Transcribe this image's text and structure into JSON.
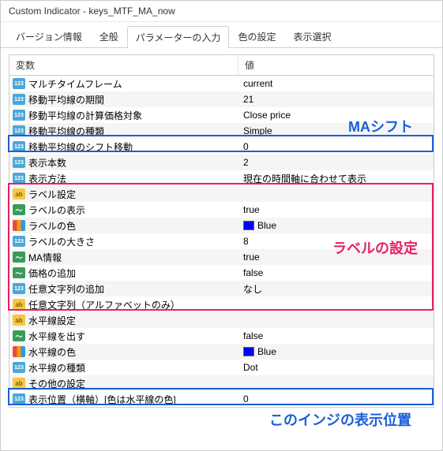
{
  "window": {
    "title": "Custom Indicator - keys_MTF_MA_now"
  },
  "tabs": [
    {
      "label": "バージョン情報"
    },
    {
      "label": "全般"
    },
    {
      "label": "パラメーターの入力"
    },
    {
      "label": "色の設定"
    },
    {
      "label": "表示選択"
    }
  ],
  "headers": {
    "variable": "変数",
    "value": "値"
  },
  "rows": [
    {
      "icon": "123",
      "var": "マルチタイムフレーム",
      "val": "current",
      "alt": false
    },
    {
      "icon": "123",
      "var": "移動平均線の期間",
      "val": "21",
      "alt": true
    },
    {
      "icon": "123",
      "var": "移動平均線の計算価格対象",
      "val": "Close price",
      "alt": false
    },
    {
      "icon": "123",
      "var": "移動平均線の種類",
      "val": "Simple",
      "alt": true
    },
    {
      "icon": "123",
      "var": "移動平均線のシフト移動",
      "val": "0",
      "alt": false
    },
    {
      "icon": "123",
      "var": "表示本数",
      "val": "2",
      "alt": true
    },
    {
      "icon": "123",
      "var": "表示方法",
      "val": "現在の時間軸に合わせて表示",
      "alt": false
    },
    {
      "icon": "ab",
      "var": "ラベル設定",
      "val": "",
      "alt": true
    },
    {
      "icon": "chart",
      "var": "ラベルの表示",
      "val": "true",
      "alt": false
    },
    {
      "icon": "color",
      "var": "ラベルの色",
      "val": "Blue",
      "alt": true,
      "swatch": "#0000ff"
    },
    {
      "icon": "123",
      "var": "ラベルの大きさ",
      "val": "8",
      "alt": false
    },
    {
      "icon": "chart",
      "var": "MA情報",
      "val": "true",
      "alt": true
    },
    {
      "icon": "chart",
      "var": "価格の追加",
      "val": "false",
      "alt": false
    },
    {
      "icon": "123",
      "var": "任意文字列の追加",
      "val": "なし",
      "alt": true
    },
    {
      "icon": "ab",
      "var": "任意文字列（アルファベットのみ）",
      "val": "",
      "alt": false
    },
    {
      "icon": "ab",
      "var": "水平線設定",
      "val": "",
      "alt": true
    },
    {
      "icon": "chart",
      "var": "水平線を出す",
      "val": "false",
      "alt": false
    },
    {
      "icon": "color",
      "var": "水平線の色",
      "val": "Blue",
      "alt": true,
      "swatch": "#0000ff"
    },
    {
      "icon": "123",
      "var": "水平線の種類",
      "val": "Dot",
      "alt": false
    },
    {
      "icon": "ab",
      "var": "その他の設定",
      "val": "",
      "alt": true
    },
    {
      "icon": "123",
      "var": "表示位置（横軸）[色は水平線の色]",
      "val": "0",
      "alt": false
    }
  ],
  "annotations": {
    "ma_shift": "MAシフト",
    "label_settings": "ラベルの設定",
    "display_position": "このインジの表示位置"
  }
}
